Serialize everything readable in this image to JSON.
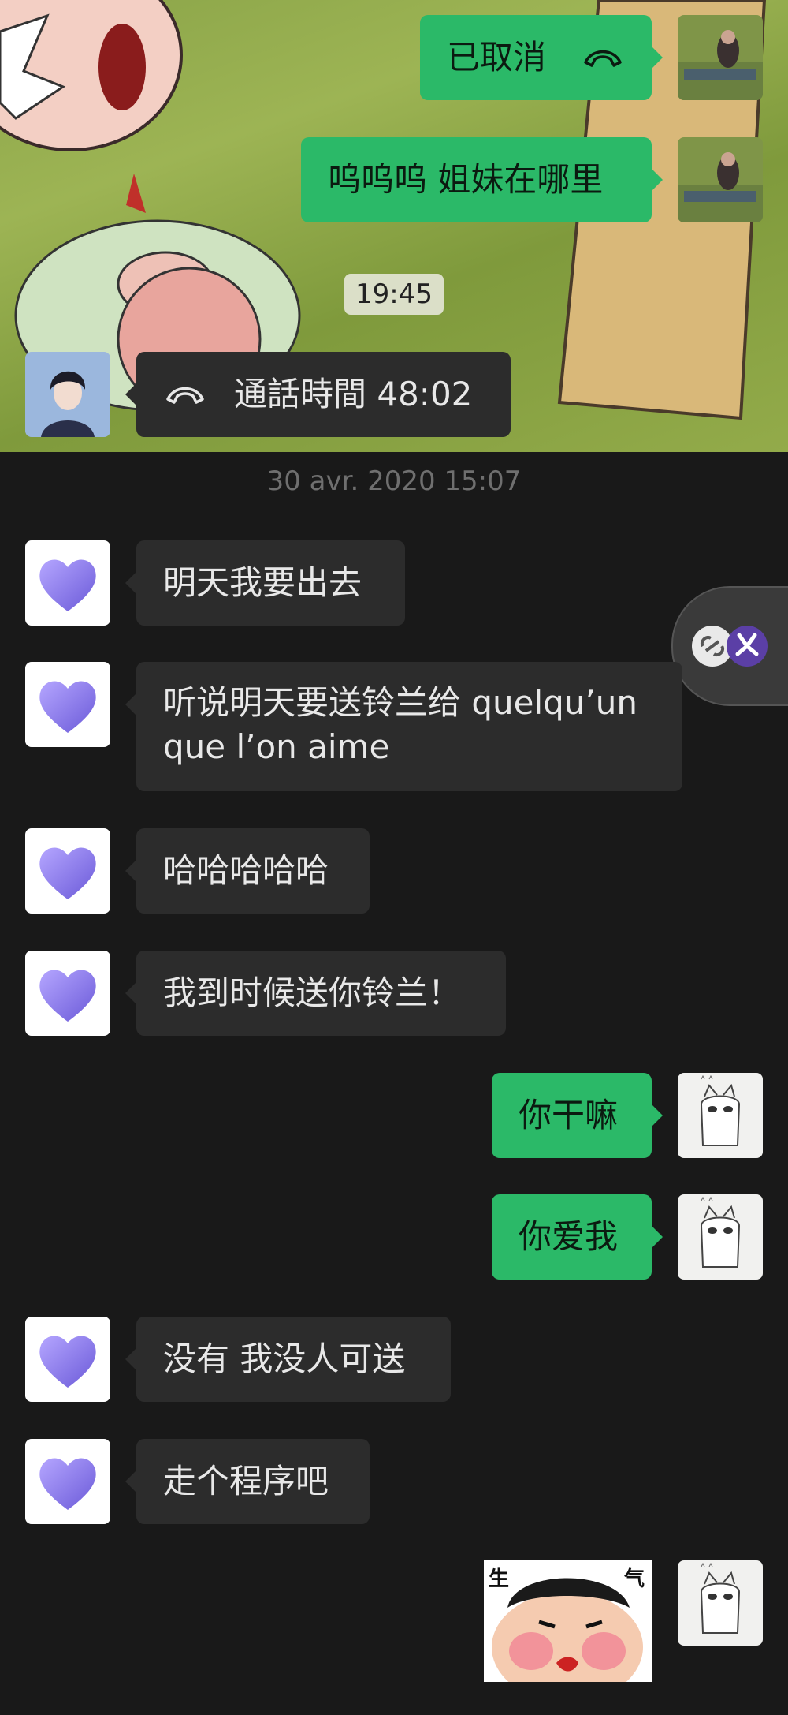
{
  "messages": {
    "m1": {
      "text": "已取消",
      "icon": "phone-hangup-icon"
    },
    "m2": {
      "text": "呜呜呜 姐妹在哪里"
    },
    "time1": "19:45",
    "m3": {
      "text": "通話時間 48:02",
      "icon": "phone-hangup-icon"
    },
    "date": "30 avr. 2020 15:07",
    "m4": {
      "text": "明天我要出去"
    },
    "m5": {
      "line1": "听说明天要送铃兰给 quelqu’un",
      "line2": "que l’on aime"
    },
    "m6": {
      "text": "哈哈哈哈哈"
    },
    "m7": {
      "text": "我到时候送你铃兰！"
    },
    "m8": {
      "text": "你干嘛"
    },
    "m9": {
      "text": "你爱我"
    },
    "m10": {
      "text": "没有 我没人可送"
    },
    "m11": {
      "text": "走个程序吧"
    },
    "sticker": {
      "left_char": "生",
      "right_char": "气"
    }
  },
  "colors": {
    "bubble_out": "#2bb968",
    "bubble_in": "#2c2c2c",
    "background": "#191919",
    "heart": "#8f7cf0"
  }
}
